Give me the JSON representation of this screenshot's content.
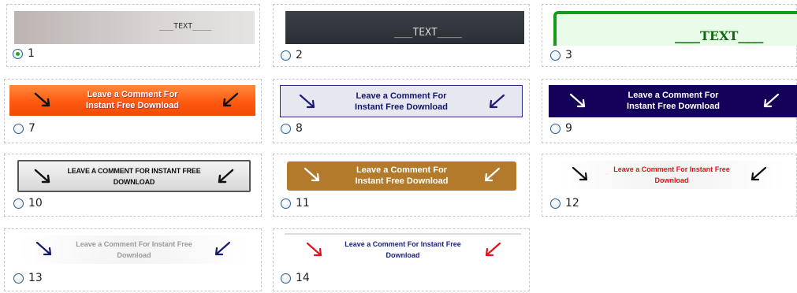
{
  "options": [
    {
      "number": "1",
      "selected": true,
      "text": "TEXT"
    },
    {
      "number": "2",
      "selected": false,
      "text": "TEXT"
    },
    {
      "number": "3",
      "selected": false,
      "text": "TEXT"
    },
    {
      "number": "7",
      "selected": false,
      "line1": "Leave a Comment For",
      "line2": "Instant Free Download"
    },
    {
      "number": "8",
      "selected": false,
      "line1": "Leave a Comment For",
      "line2": "Instant Free Download"
    },
    {
      "number": "9",
      "selected": false,
      "line1": "Leave a Comment For",
      "line2": "Instant Free Download"
    },
    {
      "number": "10",
      "selected": false,
      "line1": "LEAVE A COMMENT FOR INSTANT FREE",
      "line2": "DOWNLOAD"
    },
    {
      "number": "11",
      "selected": false,
      "line1": "Leave a Comment For",
      "line2": "Instant Free Download"
    },
    {
      "number": "12",
      "selected": false,
      "line1": "Leave a Comment For Instant Free",
      "line2": "Download"
    },
    {
      "number": "13",
      "selected": false,
      "line1": "Leave a Comment For Instant Free",
      "line2": "Download"
    },
    {
      "number": "14",
      "selected": false,
      "line1": "Leave a Comment For Instant Free",
      "line2": "Download"
    }
  ],
  "colors": {
    "radio_checked": "#26a826",
    "style3_accent": "#1a9a1a",
    "style7_bg": "#ff5a10",
    "style9_bg": "#15005a",
    "style11_bg": "#b27a2a",
    "style12_text": "#e8101a",
    "style14_text": "#1a237e"
  }
}
